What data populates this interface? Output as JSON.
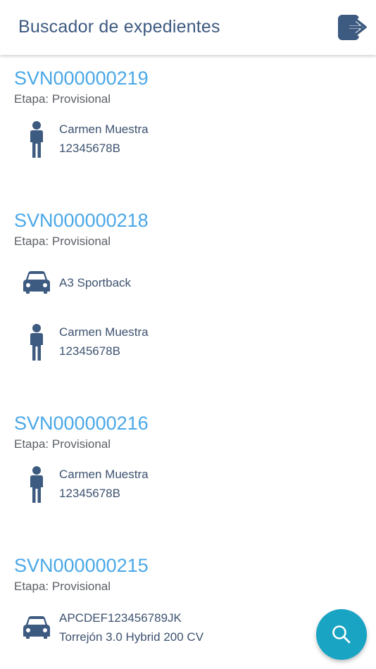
{
  "header": {
    "title": "Buscador de expedientes",
    "logout_icon": "logout-icon"
  },
  "records": [
    {
      "id": "SVN000000219",
      "stage": "Etapa: Provisional",
      "entries": [
        {
          "icon": "person-icon",
          "line1": "Carmen Muestra",
          "line2": "12345678B"
        }
      ]
    },
    {
      "id": "SVN000000218",
      "stage": "Etapa: Provisional",
      "entries": [
        {
          "icon": "car-icon",
          "line1": "A3 Sportback",
          "line2": ""
        },
        {
          "icon": "person-icon",
          "line1": "Carmen Muestra",
          "line2": "12345678B"
        }
      ]
    },
    {
      "id": "SVN000000216",
      "stage": "Etapa: Provisional",
      "entries": [
        {
          "icon": "person-icon",
          "line1": "Carmen Muestra",
          "line2": "12345678B"
        }
      ]
    },
    {
      "id": "SVN000000215",
      "stage": "Etapa: Provisional",
      "entries": [
        {
          "icon": "car-icon",
          "line1": "APCDEF123456789JK",
          "line2": "Torrejón 3.0 Hybrid 200 CV"
        }
      ]
    }
  ],
  "fab": {
    "icon": "search-icon"
  },
  "colors": {
    "accent": "#4aa8e8",
    "icon": "#3d5a80",
    "fab": "#1aa4c4"
  }
}
